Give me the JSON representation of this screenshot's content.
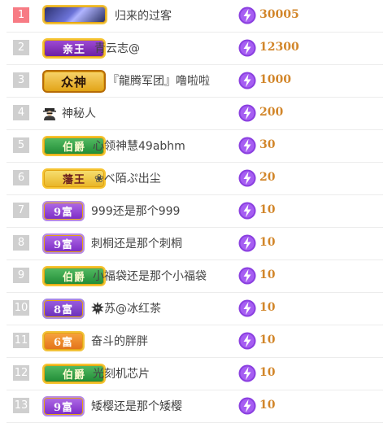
{
  "leaderboard": {
    "rows": [
      {
        "rank": "1",
        "badge": "",
        "name": "归来的过客",
        "score": "30005"
      },
      {
        "rank": "2",
        "badge": "亲王",
        "name": "青云志@",
        "score": "12300"
      },
      {
        "rank": "3",
        "badge": "众神",
        "name": "『龍腾军团』噜啦啦",
        "score": "1000"
      },
      {
        "rank": "4",
        "badge": "",
        "name": "神秘人",
        "score": "200"
      },
      {
        "rank": "5",
        "badge": "伯爵",
        "name": "心领神慧49abhm",
        "score": "30"
      },
      {
        "rank": "6",
        "badge": "藩王",
        "name": "❀ベ陌ぷ出尘",
        "score": "20"
      },
      {
        "rank": "7",
        "badge": "9富",
        "name": "999还是那个999",
        "score": "10"
      },
      {
        "rank": "8",
        "badge": "9富",
        "name": "刺桐还是那个刺桐",
        "score": "10"
      },
      {
        "rank": "9",
        "badge": "伯爵",
        "name": "小福袋还是那个小福袋",
        "score": "10"
      },
      {
        "rank": "10",
        "badge": "8富",
        "name": "苏@冰红茶",
        "score": "10"
      },
      {
        "rank": "11",
        "badge": "6富",
        "name": "奋斗的胖胖",
        "score": "10"
      },
      {
        "rank": "12",
        "badge": "伯爵",
        "name": "光刻机芯片",
        "score": "10"
      },
      {
        "rank": "13",
        "badge": "9富",
        "name": "矮樱还是那个矮樱",
        "score": "10"
      }
    ]
  },
  "icons": {
    "score": "lightning-orb-icon",
    "mystery_avatar": "incognito-person-icon",
    "spiky_avatar": "spiky-creature-icon"
  },
  "colors": {
    "rank_top": "#f77b84",
    "rank_default": "#cfcfcf",
    "score_text": "#d2862a",
    "orb_purple": "#8a3fe0"
  }
}
